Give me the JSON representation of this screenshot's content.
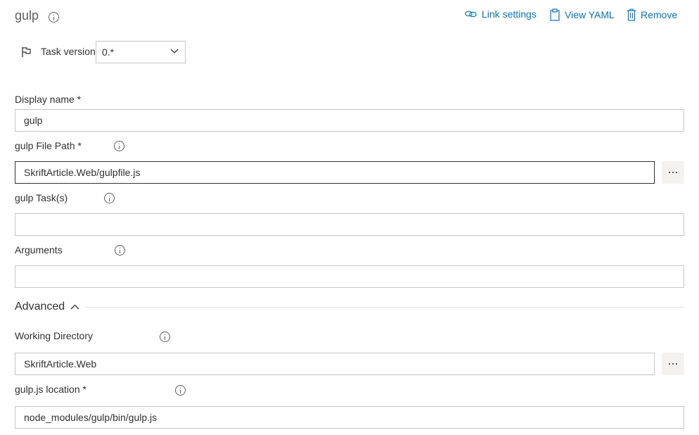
{
  "task": {
    "title": "gulp"
  },
  "actions": {
    "link_settings": "Link settings",
    "view_yaml": "View YAML",
    "remove": "Remove"
  },
  "task_version": {
    "label": "Task version",
    "value": "0.*"
  },
  "fields": {
    "display_name": {
      "label": "Display name",
      "required": "*",
      "value": "gulp"
    },
    "gulp_file_path": {
      "label": "gulp File Path",
      "required": "*",
      "value": "SkriftArticle.Web/gulpfile.js"
    },
    "gulp_tasks": {
      "label": "gulp Task(s)",
      "value": ""
    },
    "arguments": {
      "label": "Arguments",
      "value": ""
    }
  },
  "advanced": {
    "label": "Advanced",
    "working_directory": {
      "label": "Working Directory",
      "value": "SkriftArticle.Web"
    },
    "gulpjs_location": {
      "label": "gulp.js location",
      "required": "*",
      "value": "node_modules/gulp/bin/gulp.js"
    }
  },
  "icons": {
    "info": "info-icon",
    "link": "link-icon",
    "clipboard": "clipboard-icon",
    "trash": "trash-icon",
    "flag": "flag-icon",
    "chevron_down": "chevron-down-icon",
    "chevron_up": "chevron-up-icon",
    "ellipsis": "ellipsis-icon"
  },
  "colors": {
    "accent": "#0078d4",
    "text": "#323130",
    "border": "#c8c6c4"
  }
}
